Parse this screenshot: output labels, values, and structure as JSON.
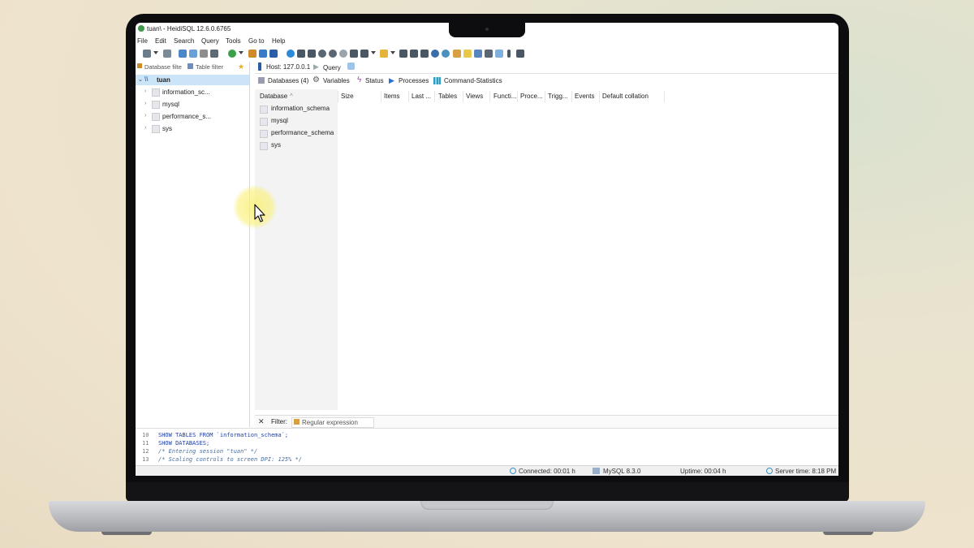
{
  "window": {
    "title": "tuan\\ - HeidiSQL 12.6.0.6765"
  },
  "menu": [
    "File",
    "Edit",
    "Search",
    "Query",
    "Tools",
    "Go to",
    "Help"
  ],
  "left": {
    "db_filter_placeholder": "Database filte",
    "table_filter_placeholder": "Table filter",
    "tree_root": "tuan",
    "tree_items": [
      "information_sc...",
      "mysql",
      "performance_s...",
      "sys"
    ]
  },
  "host": {
    "label": "Host: 127.0.0.1",
    "query_tab": "Query"
  },
  "tabs": [
    "Databases (4)",
    "Variables",
    "Status",
    "Processes",
    "Command-Statistics"
  ],
  "grid": {
    "columns": [
      "Database",
      "Size",
      "Items",
      "Last ...",
      "Tables",
      "Views",
      "Functi...",
      "Proce...",
      "Trigg...",
      "Events",
      "Default collation"
    ],
    "sort_indicator": "^",
    "rows": [
      "information_schema",
      "mysql",
      "performance_schema",
      "sys"
    ]
  },
  "filter": {
    "label": "Filter:",
    "placeholder": "Regular expression"
  },
  "sql_log": [
    {
      "n": "10",
      "text": "SHOW TABLES FROM `information_schema`;"
    },
    {
      "n": "11",
      "text": "SHOW DATABASES;"
    },
    {
      "n": "12",
      "text": "/* Entering session \"tuan\" */"
    },
    {
      "n": "13",
      "text": "/* Scaling controls to screen DPI: 125% */"
    }
  ],
  "status": {
    "connected": "Connected: 00:01 h",
    "server": "MySQL 8.3.0",
    "uptime": "Uptime: 00:04 h",
    "server_time": "Server time: 8:18 PM"
  },
  "colors": {
    "tree_selected": "#cce4f7",
    "sql_keyword": "#1c3ea8",
    "sql_comment": "#4a6fa0",
    "sql_string": "#8a3a8a",
    "cursor_highlight": "#faf078"
  }
}
